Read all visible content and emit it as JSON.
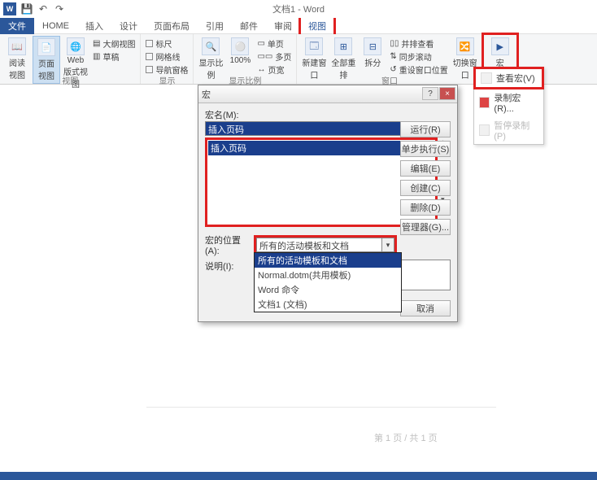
{
  "app": {
    "doc_title": "文档1 - Word"
  },
  "qat": {
    "word": "W",
    "save": "💾",
    "undo": "↶",
    "redo": "↷"
  },
  "tabs": {
    "file": "文件",
    "home": "HOME",
    "insert": "插入",
    "design": "设计",
    "layout": "页面布局",
    "ref": "引用",
    "mail": "邮件",
    "review": "审阅",
    "view": "视图"
  },
  "ribbon": {
    "views": {
      "read": "阅读\n视图",
      "page": "页面视图",
      "web": "Web 版式视图",
      "outline": "大纲视图",
      "draft": "草稿",
      "group": "视图"
    },
    "show": {
      "ruler": "标尺",
      "grid": "网格线",
      "nav": "导航窗格",
      "group": "显示"
    },
    "zoom": {
      "zoom": "显示比例",
      "p100": "100%",
      "one": "单页",
      "multi": "多页",
      "width": "页宽",
      "group": "显示比例"
    },
    "window": {
      "new": "新建窗口",
      "all": "全部重排",
      "split": "拆分",
      "side": "并排查看",
      "sync": "同步滚动",
      "reset": "重设窗口位置",
      "switch": "切换窗口",
      "group": "窗口"
    },
    "macro": {
      "btn": "宏",
      "group": "宏"
    }
  },
  "macro_menu": {
    "view": "查看宏(V)",
    "record": "录制宏(R)...",
    "pause": "暂停录制(P)"
  },
  "dialog": {
    "title": "宏",
    "name_lbl": "宏名(M):",
    "name_val": "插入页码",
    "list_sel": "插入页码",
    "loc_lbl": "宏的位置(A):",
    "loc_val": "所有的活动模板和文档",
    "desc_lbl": "说明(I):",
    "buttons": {
      "run": "运行(R)",
      "step": "单步执行(S)",
      "edit": "编辑(E)",
      "create": "创建(C)",
      "delete": "删除(D)",
      "organizer": "管理器(G)..."
    },
    "dropdown": {
      "o1": "所有的活动模板和文档",
      "o2": "Normal.dotm(共用模板)",
      "o3": "Word 命令",
      "o4": "文档1 (文档)"
    },
    "cancel": "取消",
    "help": "?",
    "close": "×"
  },
  "footer": {
    "page": "第 1 页 / 共 1 页"
  }
}
